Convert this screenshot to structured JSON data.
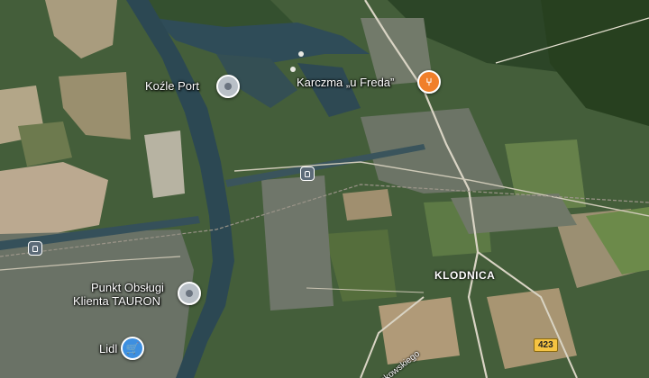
{
  "places": {
    "kozle_port": "Koźle Port",
    "karczma": "Karczma „u Freda”",
    "tauron_line1": "Punkt Obsługi",
    "tauron_line2": "Klienta TAURON",
    "lidl": "Lidl",
    "klodnica": "KLODNICA"
  },
  "road": {
    "shield_number": "423",
    "street_fragment": "nkowskiego"
  },
  "icons": {
    "kozle_port": "map-pin-icon",
    "karczma": "restaurant-icon",
    "tauron": "map-pin-icon",
    "lidl": "shopping-cart-icon",
    "stations": "train-station-icon"
  },
  "colors": {
    "forest": "#2f4a2a",
    "field_light": "#b7a98a",
    "water": "#2e4a5a",
    "road": "#d9d4c4",
    "food_pin": "#f07f2a",
    "shop_pin": "#3d8fe0",
    "route_shield": "#f5c342"
  }
}
